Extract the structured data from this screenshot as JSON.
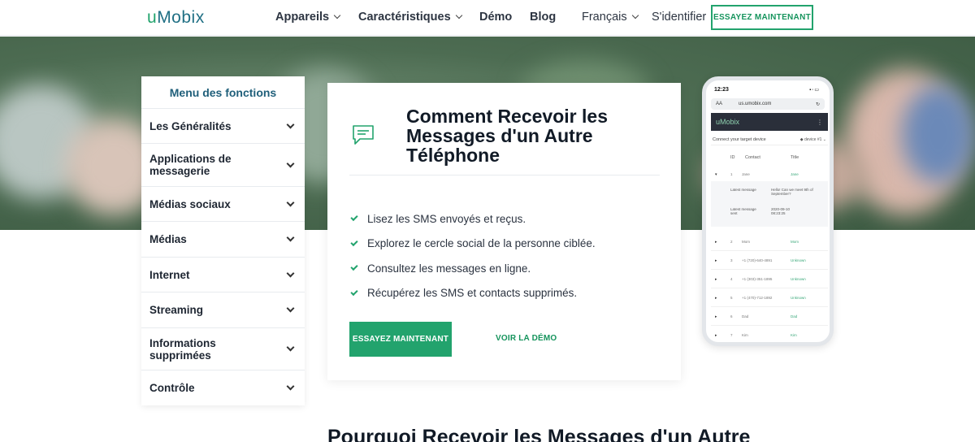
{
  "header": {
    "logo_u": "u",
    "logo_rest": "Mobix",
    "nav": {
      "appareils": "Appareils",
      "caracteristiques": "Caractéristiques",
      "demo": "Démo",
      "blog": "Blog",
      "langue": "Français",
      "login": "S'identifier"
    },
    "cta": "ESSAYEZ MAINTENANT"
  },
  "sidebar": {
    "title": "Menu des fonctions",
    "items": [
      {
        "label": "Les Généralités"
      },
      {
        "label": "Applications de messagerie"
      },
      {
        "label": "Médias sociaux"
      },
      {
        "label": "Médias"
      },
      {
        "label": "Internet"
      },
      {
        "label": "Streaming"
      },
      {
        "label": "Informations supprimées"
      },
      {
        "label": "Contrôle"
      }
    ]
  },
  "card": {
    "title": "Comment Recevoir les Messages d'un Autre Téléphone",
    "features": [
      "Lisez les SMS envoyés et reçus.",
      "Explorez le cercle social de la personne ciblée.",
      "Consultez les messages en ligne.",
      "Récupérez les SMS et contacts supprimés."
    ],
    "primary_button": "ESSAYEZ MAINTENANT",
    "demo_link": "VOIR LA DÉMO",
    "accent": "#22a36d"
  },
  "phone": {
    "time": "12:23",
    "url_aa": "AA",
    "url": "us.umobix.com",
    "app_name": "uMobix",
    "target_label": "Connect your target device",
    "device": "device #1",
    "col_id": "ID",
    "col_contact": "Contact",
    "col_title": "Title",
    "row1": {
      "id": "1",
      "contact": "Jane",
      "title": "Jane"
    },
    "expand": {
      "latest_label": "Latest message",
      "latest_text": "Hello! Can we meet 9th of September?",
      "sent_label": "Latest message sent",
      "sent_value": "2020-09-10 08:23:25"
    },
    "rows": [
      {
        "id": "2",
        "contact": "Mom",
        "title": "Mom"
      },
      {
        "id": "3",
        "contact": "+1 (720)-640-4891",
        "title": "Unknown"
      },
      {
        "id": "4",
        "contact": "+1 (303)-351-1895",
        "title": "Unknown"
      },
      {
        "id": "5",
        "contact": "+1 (470)-712-1892",
        "title": "Unknown"
      },
      {
        "id": "6",
        "contact": "Dad",
        "title": "Dad"
      },
      {
        "id": "7",
        "contact": "Kim",
        "title": "Kim"
      }
    ]
  },
  "section_heading": "Pourquoi Recevoir les Messages d'un Autre"
}
